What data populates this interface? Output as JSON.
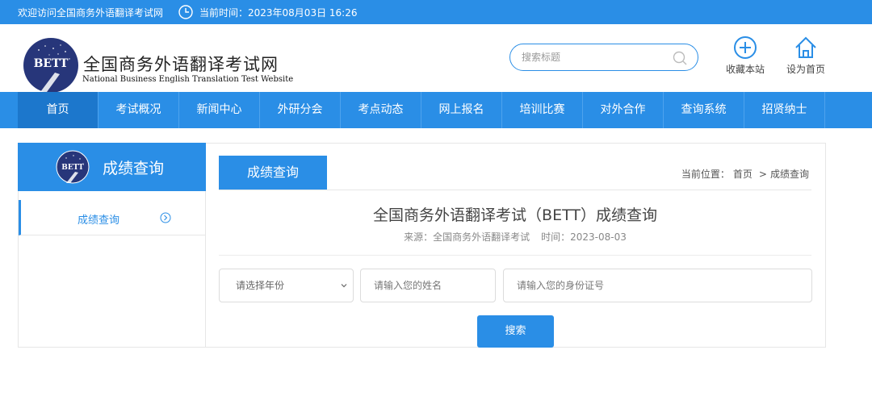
{
  "topbar": {
    "welcome": "欢迎访问全国商务外语翻译考试网",
    "time": "当前时间：2023年08月03日 16:26",
    "clock_icon": "clock-icon"
  },
  "header": {
    "logo_text": "BETT",
    "site_title": "全国商务外语翻译考试网",
    "site_subtitle": "National Business English Translation Test Website",
    "search_placeholder": "搜索标题",
    "favorite_label": "收藏本站",
    "homepage_label": "设为首页"
  },
  "nav": {
    "items": [
      {
        "label": "首页",
        "active": true
      },
      {
        "label": "考试概况"
      },
      {
        "label": "新闻中心"
      },
      {
        "label": "外研分会"
      },
      {
        "label": "考点动态"
      },
      {
        "label": "网上报名"
      },
      {
        "label": "培训比赛"
      },
      {
        "label": "对外合作"
      },
      {
        "label": "查询系统"
      },
      {
        "label": "招贤纳士"
      }
    ]
  },
  "sidebar": {
    "title": "成绩查询",
    "badge_text": "BETT",
    "items": [
      {
        "label": "成绩查询"
      }
    ]
  },
  "main": {
    "tab_label": "成绩查询",
    "breadcrumb": {
      "prefix": "当前位置：",
      "home": "首页",
      "sep": ">",
      "current": "成绩查询"
    },
    "article_title": "全国商务外语翻译考试（BETT）成绩查询",
    "meta_source": "来源：全国商务外语翻译考试",
    "meta_time": "时间：2023-08-03",
    "form": {
      "year_placeholder": "请选择年份",
      "name_placeholder": "请输入您的姓名",
      "id_placeholder": "请输入您的身份证号",
      "search_button": "搜索"
    }
  },
  "colors": {
    "accent": "#2a8ee6",
    "nav_active": "#1c77cc",
    "logo_navy": "#27367a"
  }
}
